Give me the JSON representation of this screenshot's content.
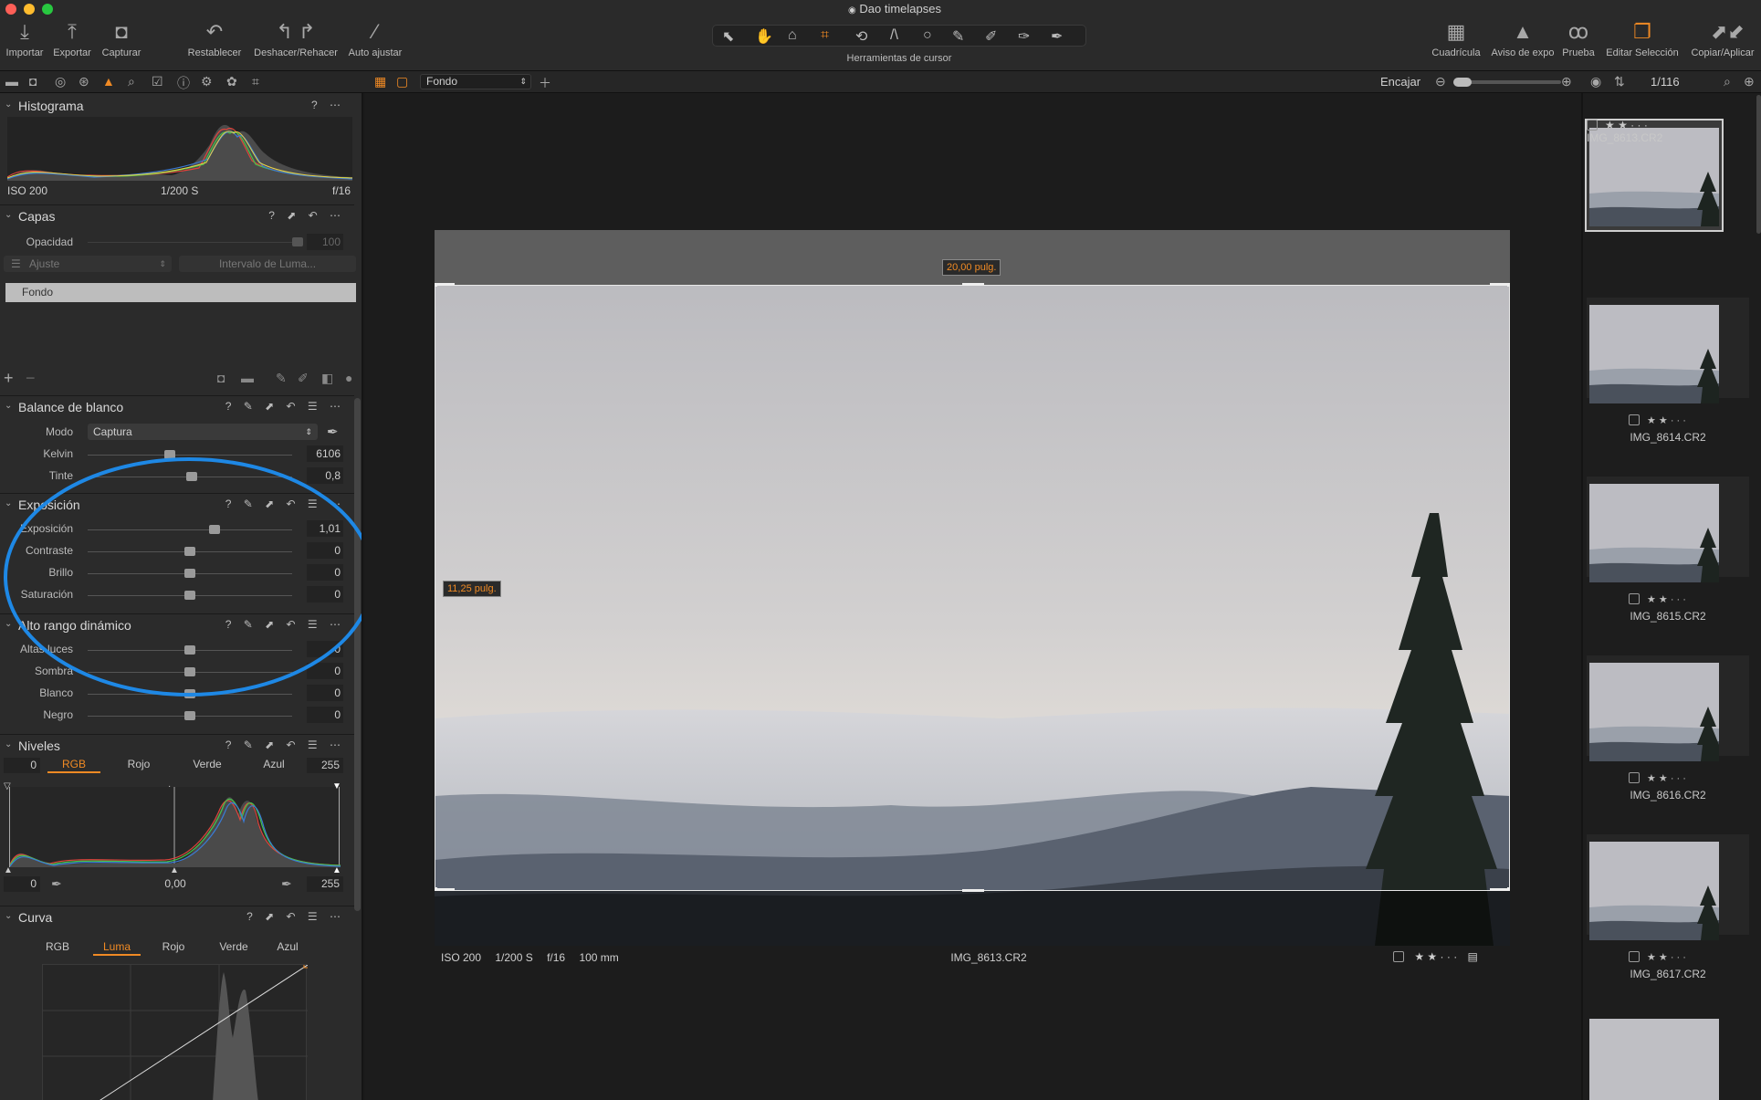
{
  "window": {
    "title": "Dao timelapses"
  },
  "toolbar": {
    "left_buttons": [
      {
        "label": "Importar",
        "icon": "download-icon"
      },
      {
        "label": "Exportar",
        "icon": "upload-icon"
      },
      {
        "label": "Capturar",
        "icon": "camera-icon"
      },
      {
        "label": "Restablecer",
        "icon": "reset-icon"
      },
      {
        "label": "Deshacer/Rehacer",
        "icon": "undo-icon"
      },
      {
        "label": "Auto ajustar",
        "icon": "magic-wand-icon"
      }
    ],
    "cursor_tools_label": "Herramientas de cursor",
    "right_buttons": [
      {
        "label": "Cuadrícula",
        "icon": "grid-icon"
      },
      {
        "label": "Aviso de expo",
        "icon": "warning-icon"
      },
      {
        "label": "Prueba",
        "icon": "glasses-icon"
      },
      {
        "label": "Editar Selección",
        "icon": "layers-stack-icon"
      },
      {
        "label": "Copiar/Aplicar",
        "icon": "copy-apply-icon"
      }
    ]
  },
  "subbar": {
    "variant_select": "Fondo",
    "fit_label": "Encajar",
    "counter": "1/116"
  },
  "histogram": {
    "title": "Histograma",
    "iso": "ISO 200",
    "shutter": "1/200 S",
    "aperture": "f/16"
  },
  "layers": {
    "title": "Capas",
    "opacity_label": "Opacidad",
    "opacity_value": "100",
    "adjust_select": "Ajuste",
    "luma_button": "Intervalo de Luma...",
    "layer_name": "Fondo"
  },
  "white_balance": {
    "title": "Balance de blanco",
    "mode_label": "Modo",
    "mode_value": "Captura",
    "rows": [
      {
        "label": "Kelvin",
        "value": "6106",
        "pos": 0.4
      },
      {
        "label": "Tinte",
        "value": "0,8",
        "pos": 0.51
      }
    ]
  },
  "exposure": {
    "title": "Exposición",
    "rows": [
      {
        "label": "Exposición",
        "value": "1,01",
        "pos": 0.62
      },
      {
        "label": "Contraste",
        "value": "0",
        "pos": 0.5
      },
      {
        "label": "Brillo",
        "value": "0",
        "pos": 0.5
      },
      {
        "label": "Saturación",
        "value": "0",
        "pos": 0.5
      }
    ]
  },
  "hdr": {
    "title": "Alto rango dinámico",
    "rows": [
      {
        "label": "Altas luces",
        "value": "0",
        "pos": 0.5
      },
      {
        "label": "Sombra",
        "value": "0",
        "pos": 0.5
      },
      {
        "label": "Blanco",
        "value": "0",
        "pos": 0.5
      },
      {
        "label": "Negro",
        "value": "0",
        "pos": 0.5
      }
    ]
  },
  "levels": {
    "title": "Niveles",
    "tabs": [
      "RGB",
      "Rojo",
      "Verde",
      "Azul"
    ],
    "in_low": "0",
    "in_high": "255",
    "out_low": "0",
    "mid": "0,00",
    "out_high": "255"
  },
  "curve": {
    "title": "Curva",
    "tabs": [
      "RGB",
      "Luma",
      "Rojo",
      "Verde",
      "Azul"
    ]
  },
  "viewer": {
    "crop_width": "20,00 pulg.",
    "crop_height": "11,25 pulg.",
    "info_iso": "ISO 200",
    "info_shutter": "1/200 S",
    "info_aperture": "f/16",
    "info_focal": "100 mm",
    "filename": "IMG_8613.CR2",
    "stars": "★ ★ · · ·"
  },
  "thumbnails": [
    {
      "name": "IMG_8613.CR2",
      "stars": "★ ★ · · ·"
    },
    {
      "name": "IMG_8614.CR2",
      "stars": "★ ★ · · ·"
    },
    {
      "name": "IMG_8615.CR2",
      "stars": "★ ★ · · ·"
    },
    {
      "name": "IMG_8616.CR2",
      "stars": "★ ★ · · ·"
    },
    {
      "name": "IMG_8617.CR2",
      "stars": "★ ★ · · ·"
    }
  ],
  "colors": {
    "accent": "#f08a24",
    "annotation": "#1e88e5"
  }
}
